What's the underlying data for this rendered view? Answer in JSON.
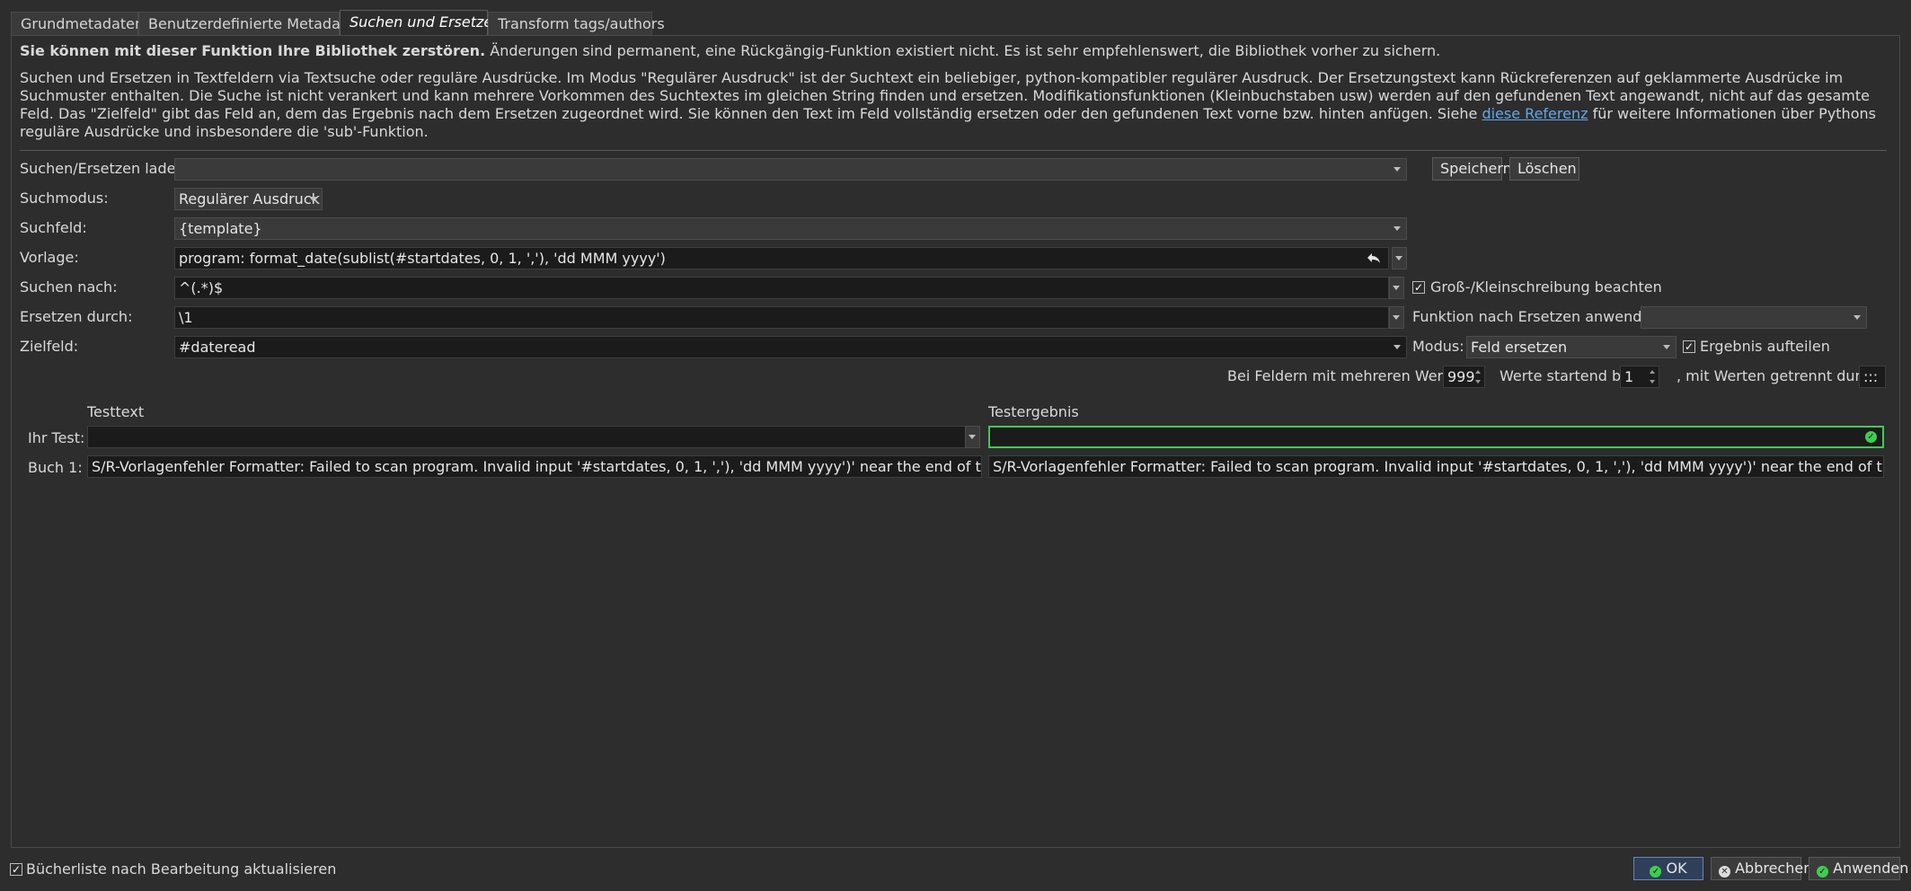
{
  "tabs": [
    "Grundmetadaten",
    "Benutzerdefinierte Metadaten",
    "Suchen und Ersetzen",
    "Transform tags/authors"
  ],
  "warning_bold": "Sie können mit dieser Funktion Ihre Bibliothek zerstören.",
  "warning_rest": " Änderungen sind permanent, eine Rückgängig-Funktion existiert nicht. Es ist sehr empfehlenswert, die Bibliothek vorher zu sichern.",
  "description_before_link": "Suchen und Ersetzen in Textfeldern via Textsuche oder reguläre Ausdrücke. Im Modus \"Regulärer Ausdruck\" ist der Suchtext ein beliebiger, python-kompatibler regulärer Ausdruck. Der Ersetzungstext kann Rückreferenzen auf geklammerte Ausdrücke im Suchmuster enthalten. Die Suche ist nicht verankert und kann mehrere Vorkommen des Suchtextes im gleichen String finden und ersetzen. Modifikationsfunktionen (Kleinbuchstaben usw) werden auf den gefundenen Text angewandt, nicht auf das gesamte Feld. Das \"Zielfeld\" gibt das Feld an, dem das Ergebnis nach dem Ersetzen zugeordnet wird. Sie können den Text im Feld vollständig ersetzen oder den gefundenen Text vorne bzw. hinten anfügen. Siehe ",
  "description_link": "diese Referenz",
  "description_after_link": " für weitere Informationen über Pythons reguläre Ausdrücke und insbesondere die 'sub'-Funktion.",
  "form": {
    "load_label": "Suchen/Ersetzen laden:",
    "load_value": "",
    "save_button": "Speichern",
    "delete_button": "Löschen",
    "mode_label": "Suchmodus:",
    "mode_value": "Regulärer Ausdruck",
    "field_label": "Suchfeld:",
    "field_value": "{template}",
    "template_label": "Vorlage:",
    "template_value": "program: format_date(sublist(#startdates, 0, 1, ','), 'dd MMM yyyy')",
    "search_label": "Suchen nach:",
    "search_value": "^(.*)$",
    "case_label": "Groß-/Kleinschreibung beachten",
    "replace_label": "Ersetzen durch:",
    "replace_value": "\\1",
    "func_label": "Funktion nach Ersetzen anwenden:",
    "func_value": "",
    "dest_label": "Zielfeld:",
    "dest_value": "#dateread",
    "modus_label": "Modus:",
    "modus_value": "Feld ersetzen",
    "split_label": "Ergebnis aufteilen",
    "multi_label": "Bei Feldern mit mehreren Werten",
    "multi_value": "999",
    "start_label": "Werte startend bei",
    "start_value": "1",
    "sep_label": ", mit Werten getrennt durch",
    "sep_value": ":::"
  },
  "test": {
    "header_text": "Testtext",
    "header_result": "Testergebnis",
    "your_test_label": "Ihr Test:",
    "your_test_value": "",
    "your_test_result": "",
    "book1_label": "Buch 1:",
    "book1_text": "S/R-Vorlagenfehler Formatter: Failed to scan program. Invalid input '#startdates, 0, 1, ','), 'dd MMM yyyy')' near the end of the program",
    "book1_result": "S/R-Vorlagenfehler Formatter: Failed to scan program. Invalid input '#startdates, 0, 1, ','), 'dd MMM yyyy')' near the end of the program"
  },
  "footer": {
    "refresh_label": "Bücherliste nach Bearbeitung aktualisieren",
    "ok": "OK",
    "cancel": "Abbrechen",
    "apply": "Anwenden"
  }
}
